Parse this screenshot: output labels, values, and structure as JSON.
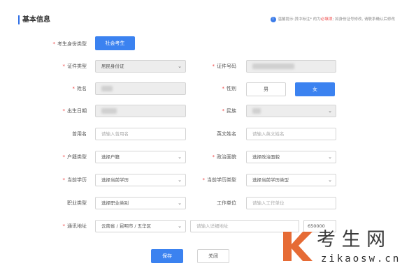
{
  "section": {
    "title": "基本信息"
  },
  "notice": {
    "part1": "温馨提示:其中标注* 的为",
    "highlight": "必填项",
    "part2": "; 如身份证号修改, 请联系确认后修改"
  },
  "fields": {
    "candidate_type": {
      "label": "考生身份类型",
      "value": "社会考生"
    },
    "id_type": {
      "label": "证件类型",
      "value": "居民身份证"
    },
    "id_number": {
      "label": "证件号码"
    },
    "name": {
      "label": "姓名"
    },
    "gender": {
      "label": "性别",
      "options": [
        "男",
        "女"
      ],
      "selected": "女"
    },
    "birth_date": {
      "label": "出生日期"
    },
    "ethnicity": {
      "label": "民族"
    },
    "former_name": {
      "label": "曾用名",
      "placeholder": "请输入曾用名"
    },
    "english_name": {
      "label": "英文姓名",
      "placeholder": "请输入英文姓名"
    },
    "household_type": {
      "label": "户籍类型",
      "value": "选择户籍"
    },
    "political_status": {
      "label": "政治面貌",
      "value": "选择政治面貌"
    },
    "education": {
      "label": "当前学历",
      "value": "选择当前学历"
    },
    "education_type": {
      "label": "当前学历类型",
      "value": "选择当前学历类型"
    },
    "occupation": {
      "label": "职业类型",
      "value": "选择职业类别"
    },
    "work_unit": {
      "label": "工作单位",
      "placeholder": "请输入工作单位"
    },
    "address": {
      "label": "通讯地址",
      "region": "云南省 / 昆明市 / 五华区",
      "placeholder": "请输入详细地址",
      "postcode": "650000"
    }
  },
  "buttons": {
    "save": "保存",
    "close": "关闭"
  },
  "watermark": {
    "brand": "考 生 网",
    "url": "zikaosw.cn"
  },
  "colors": {
    "accent": "#3b82f0",
    "required": "#e44444"
  }
}
